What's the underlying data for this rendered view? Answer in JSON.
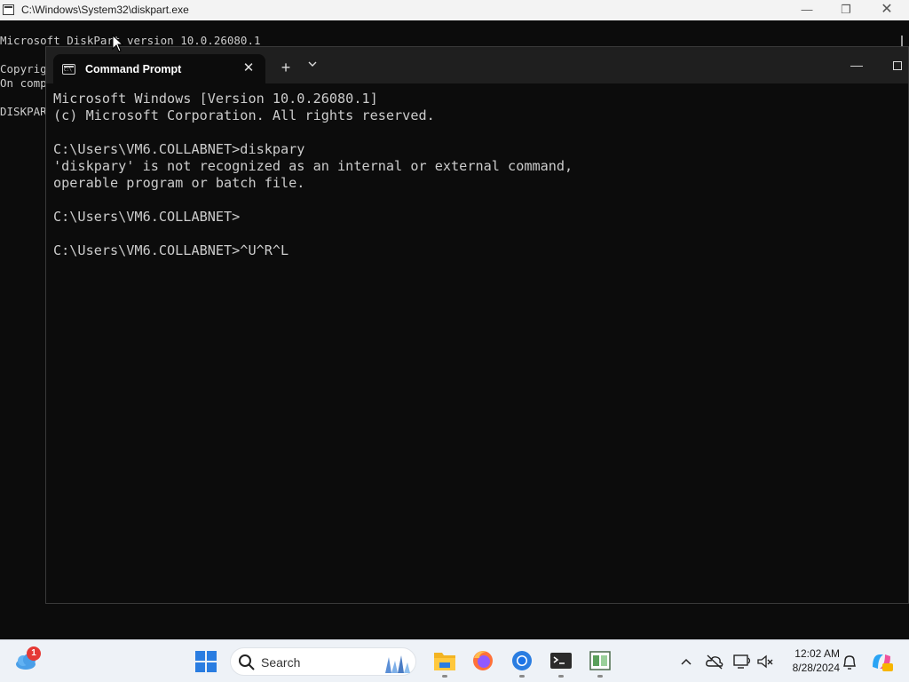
{
  "diskpart_window": {
    "title": "C:\\Windows\\System32\\diskpart.exe",
    "lines": [
      "Microsoft DiskPart version 10.0.26080.1",
      "",
      "Copyrig",
      "On comp",
      "",
      "DISKPAR"
    ]
  },
  "terminal": {
    "tab_title": "Command Prompt",
    "lines": [
      "Microsoft Windows [Version 10.0.26080.1]",
      "(c) Microsoft Corporation. All rights reserved.",
      "",
      "C:\\Users\\VM6.COLLABNET>diskpary",
      "'diskpary' is not recognized as an internal or external command,",
      "operable program or batch file.",
      "",
      "C:\\Users\\VM6.COLLABNET>",
      "",
      "C:\\Users\\VM6.COLLABNET>^U^R^L"
    ]
  },
  "taskbar": {
    "widgets_badge": "1",
    "search_placeholder": "Search",
    "clock_time": "12:02 AM",
    "clock_date": "8/28/2024",
    "pinned_apps": [
      "file-explorer",
      "firefox",
      "chrome",
      "terminal",
      "diskpart"
    ]
  },
  "colors": {
    "console_bg": "#0c0c0c",
    "console_text": "#cccccc",
    "tabbar_bg": "#1f1f1f",
    "taskbar_bg": "#eef2f7"
  }
}
